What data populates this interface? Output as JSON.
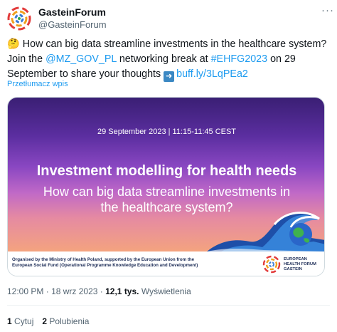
{
  "tweet": {
    "author": {
      "name": "GasteinForum",
      "handle": "@GasteinForum",
      "avatar_icon": "gastein-forum-logo-icon"
    },
    "more_icon": "more-options-icon",
    "text": {
      "emoji": "🤔",
      "part1": "How can big data streamline investments in the healthcare system? Join the",
      "mention": "@MZ_GOV_PL",
      "part2": "networking break at",
      "hashtag": "#EHFG2023",
      "part3": "on 29 September to share your thoughts",
      "arrow_icon": "right-arrow-emoji-icon",
      "link": "buff.ly/3LqPEa2"
    },
    "translate_label": "Przetłumacz wpis",
    "card": {
      "date": "29 September  2023 | 11:15-11:45 CEST",
      "headline": "Investment modelling for health needs",
      "subline1": "How can big data streamline investments in",
      "subline2": "the healthcare system?",
      "footer_line1": "Organised by the Ministry of Health Poland, supported by the European Union from the",
      "footer_line2": "European Social Fund (Operational Programme Knowledge Education and Development)",
      "logo_line1": "EUROPEAN",
      "logo_line2": "HEALTH FORUM",
      "logo_line3": "GASTEIN"
    },
    "meta": {
      "time": "12:00 PM",
      "sep1": "·",
      "date": "18 wrz 2023",
      "sep2": "·",
      "views_count": "12,1 tys.",
      "views_label": "Wyświetlenia"
    },
    "stats": {
      "quotes_count": "1",
      "quotes_label": "Cytuj",
      "likes_count": "2",
      "likes_label": "Polubienia"
    },
    "colors": {
      "link": "#1d9bf0",
      "text": "#0f1419",
      "muted": "#536471"
    }
  }
}
